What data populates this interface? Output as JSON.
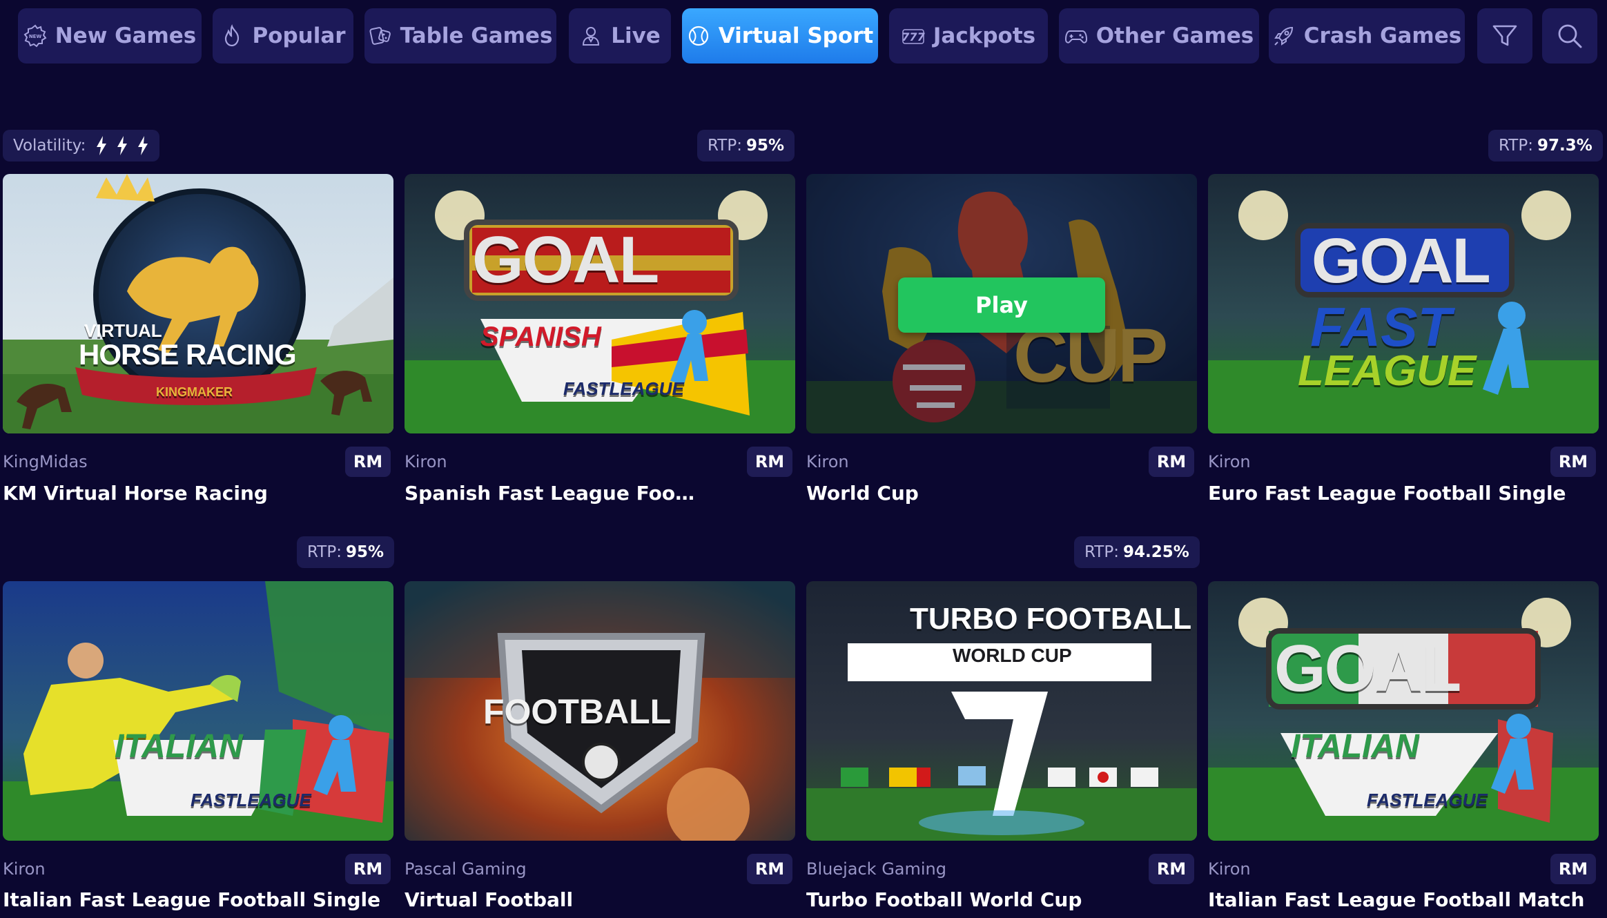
{
  "nav": {
    "tabs": [
      {
        "label": "New Games",
        "icon": "new-badge-icon",
        "active": false
      },
      {
        "label": "Popular",
        "icon": "flame-icon",
        "active": false
      },
      {
        "label": "Table Games",
        "icon": "cards-dice-icon",
        "active": false
      },
      {
        "label": "Live",
        "icon": "dealer-icon",
        "active": false
      },
      {
        "label": "Virtual Sport",
        "icon": "ball-icon",
        "active": true
      },
      {
        "label": "Jackpots",
        "icon": "sevens-icon",
        "active": false
      },
      {
        "label": "Other Games",
        "icon": "gamepad-icon",
        "active": false
      },
      {
        "label": "Crash Games",
        "icon": "rocket-icon",
        "active": false
      }
    ],
    "filter_icon": "filter-icon",
    "search_icon": "search-icon"
  },
  "colors": {
    "background": "#0b0730",
    "tab": "#1c1958",
    "tab_text": "#a6a3de",
    "active_tab": "#2a8ff5",
    "play_button": "#22c55e"
  },
  "badges": {
    "volatility_label": "Volatility:",
    "volatility_level": 3,
    "rtp_label": "RTP:"
  },
  "games": [
    {
      "provider": "KingMidas",
      "title": "KM Virtual Horse Racing",
      "currency": "RM",
      "volatility": 3
    },
    {
      "provider": "Kiron",
      "title": "Spanish Fast League Football Single",
      "currency": "RM",
      "rtp": "95%"
    },
    {
      "provider": "Kiron",
      "title": "World Cup",
      "currency": "RM",
      "hovered": true
    },
    {
      "provider": "Kiron",
      "title": "Euro Fast League Football Single",
      "currency": "RM",
      "rtp": "97.3%"
    },
    {
      "provider": "Kiron",
      "title": "Italian Fast League Football Single",
      "currency": "RM"
    },
    {
      "provider": "Pascal Gaming",
      "title": "Virtual Football",
      "currency": "RM",
      "rtp": "95%"
    },
    {
      "provider": "Bluejack Gaming",
      "title": "Turbo Football World Cup",
      "currency": "RM"
    },
    {
      "provider": "Kiron",
      "title": "Italian Fast League Football Match",
      "currency": "RM",
      "rtp": "94.25%"
    }
  ],
  "hover": {
    "play_label": "Play"
  },
  "art": {
    "horse_top": "VIRTUAL",
    "horse_main": "HORSE RACING",
    "horse_brand": "KINGMAKER",
    "goal": "GOAL",
    "spanish": "SPANISH",
    "fast_league": "FASTLEAGUE",
    "world_cup_big": "CUP",
    "fast": "FAST",
    "league": "LEAGUE",
    "italian": "ITALIAN",
    "football": "FOOTBALL",
    "turbo": "TURBO FOOTBALL",
    "turbo_sub": "WORLD CUP"
  }
}
